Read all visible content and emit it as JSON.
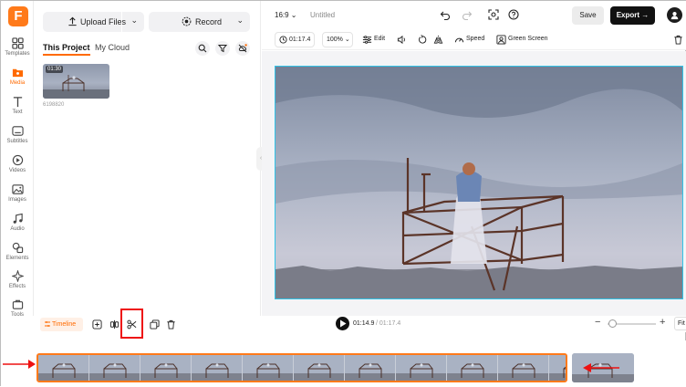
{
  "app": {
    "logo_letter": "F",
    "accent_color": "#ff6a00"
  },
  "rail": {
    "items": [
      {
        "label": "Templates",
        "icon": "templates-icon"
      },
      {
        "label": "Media",
        "icon": "media-folder-icon",
        "active": true
      },
      {
        "label": "Text",
        "icon": "text-icon"
      },
      {
        "label": "Subtitles",
        "icon": "subtitles-icon"
      },
      {
        "label": "Videos",
        "icon": "videos-icon"
      },
      {
        "label": "Images",
        "icon": "images-icon"
      },
      {
        "label": "Audio",
        "icon": "audio-icon"
      },
      {
        "label": "Elements",
        "icon": "elements-icon"
      },
      {
        "label": "Effects",
        "icon": "effects-icon"
      },
      {
        "label": "Tools",
        "icon": "tools-icon"
      }
    ]
  },
  "media_panel": {
    "upload_label": "Upload Files",
    "record_label": "Record",
    "tabs": [
      {
        "label": "This Project",
        "active": true
      },
      {
        "label": "My Cloud",
        "active": false
      }
    ],
    "clip": {
      "duration": "01:30",
      "name": "6198820"
    }
  },
  "topbar": {
    "aspect_ratio": "16:9",
    "project_title": "Untitled",
    "save_label": "Save",
    "export_label": "Export"
  },
  "editor_toolbar": {
    "duration": "01:17.4",
    "zoom": "100%",
    "edit_label": "Edit",
    "speed_label": "Speed",
    "green_screen_label": "Green Screen"
  },
  "timeline": {
    "timeline_label": "Timeline",
    "current_time": "01:14.9",
    "total_time": "/ 01:17.4",
    "fit_label": "Fit",
    "zoom_level": 0.1
  }
}
